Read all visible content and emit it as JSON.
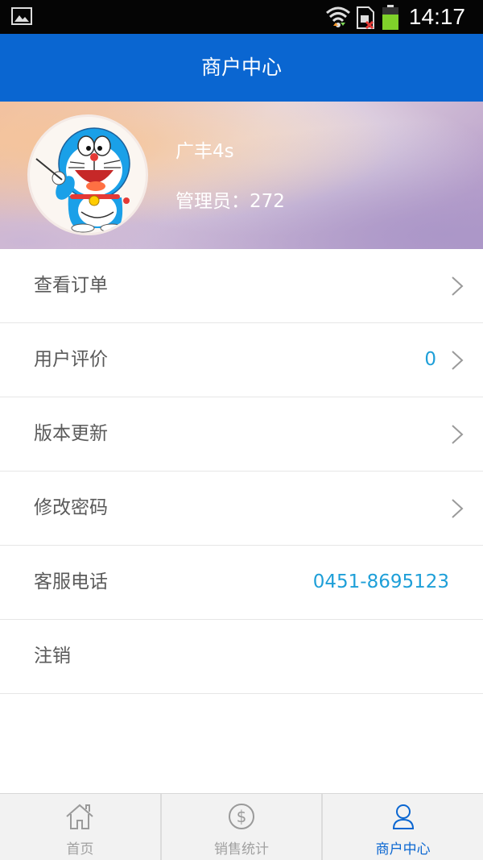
{
  "status_bar": {
    "time": "14:17",
    "icons": [
      "gallery-icon",
      "wifi-icon",
      "sim-icon",
      "battery-icon"
    ]
  },
  "header": {
    "title": "商户中心"
  },
  "profile": {
    "merchant_name": "广丰4s",
    "admin_text": "管理员：272",
    "avatar": "doraemon-avatar"
  },
  "menu": {
    "items": [
      {
        "label": "查看订单",
        "value": "",
        "chevron": true
      },
      {
        "label": "用户评价",
        "value": "0",
        "chevron": true
      },
      {
        "label": "版本更新",
        "value": "",
        "chevron": true
      },
      {
        "label": "修改密码",
        "value": "",
        "chevron": true
      },
      {
        "label": "客服电话",
        "value": "0451-8695123",
        "chevron": false
      },
      {
        "label": "注销",
        "value": "",
        "chevron": false
      }
    ]
  },
  "bottom_nav": {
    "tabs": [
      {
        "label": "首页",
        "icon": "home-icon",
        "active": false
      },
      {
        "label": "销售统计",
        "icon": "dollar-icon",
        "active": false
      },
      {
        "label": "商户中心",
        "icon": "user-icon",
        "active": true
      }
    ]
  },
  "colors": {
    "primary": "#0a66d1",
    "accent_value": "#1e9fd8",
    "inactive_nav": "#a0a0a0"
  }
}
